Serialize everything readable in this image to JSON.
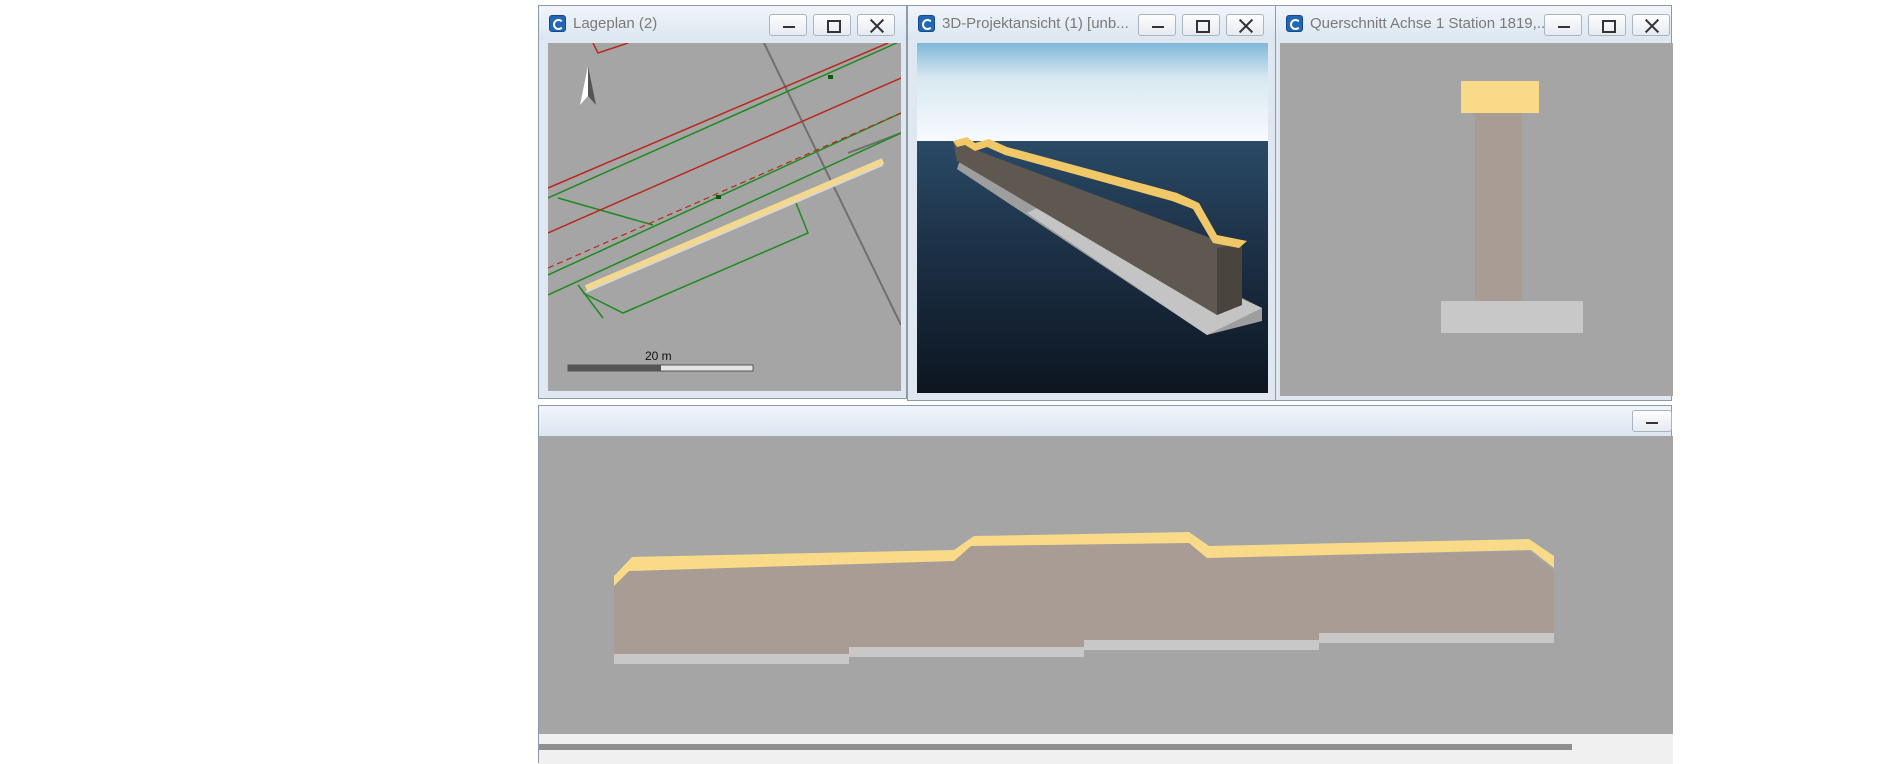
{
  "windows": {
    "lageplan": {
      "title": "Lageplan (2)",
      "scale_label": "20 m"
    },
    "projektansicht": {
      "title": "3D-Projektansicht (1) [unb..."
    },
    "querschnitt": {
      "title": "Querschnitt Achse 1 Station 1819,..."
    }
  },
  "icons": {
    "app": "app-logo-icon",
    "minimize": "minimize-icon",
    "maximize": "maximize-icon",
    "close": "close-icon",
    "north_arrow": "north-arrow-icon"
  },
  "colors": {
    "view_background": "#a5a5a5",
    "wall_body": "#a89c94",
    "wall_cap": "#f8da88",
    "foundation": "#c8c8c8",
    "axis_red": "#b9281c",
    "boundary_green": "#1e8a1e"
  }
}
